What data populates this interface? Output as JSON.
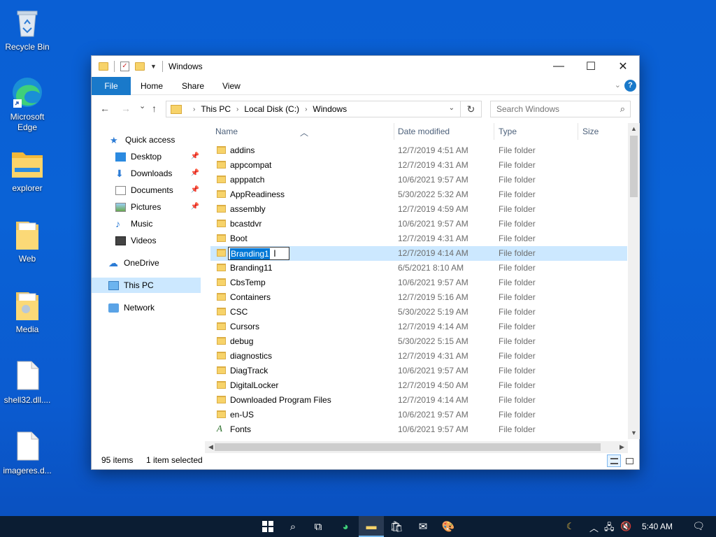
{
  "desktop": {
    "icons": [
      {
        "label": "Recycle Bin",
        "icon": "recycle-bin-icon"
      },
      {
        "label": "Microsoft Edge",
        "icon": "edge-icon"
      },
      {
        "label": "explorer",
        "icon": "folder-icon"
      },
      {
        "label": "Web",
        "icon": "folder-icon"
      },
      {
        "label": "Media",
        "icon": "folder-icon"
      },
      {
        "label": "shell32.dll....",
        "icon": "file-icon"
      },
      {
        "label": "imageres.d...",
        "icon": "file-icon"
      }
    ]
  },
  "window": {
    "title": "Windows",
    "controls": {
      "minimize": "—",
      "maximize": "☐",
      "close": "✕"
    },
    "ribbon": {
      "tabs": [
        "File",
        "Home",
        "Share",
        "View"
      ],
      "help": "?"
    },
    "nav": {
      "back": "←",
      "forward": "→",
      "recent": "⌄",
      "up": "↑",
      "breadcrumb": [
        "This PC",
        "Local Disk (C:)",
        "Windows"
      ],
      "search_placeholder": "Search Windows"
    },
    "navpane": {
      "quick_access": "Quick access",
      "pinned": [
        "Desktop",
        "Downloads",
        "Documents",
        "Pictures"
      ],
      "unpinned": [
        "Music",
        "Videos"
      ],
      "onedrive": "OneDrive",
      "this_pc": "This PC",
      "network": "Network"
    },
    "columns": {
      "name": "Name",
      "date": "Date modified",
      "type": "Type",
      "size": "Size"
    },
    "files": [
      {
        "name": "addins",
        "date": "12/7/2019 4:51 AM",
        "type": "File folder"
      },
      {
        "name": "appcompat",
        "date": "12/7/2019 4:31 AM",
        "type": "File folder"
      },
      {
        "name": "apppatch",
        "date": "10/6/2021 9:57 AM",
        "type": "File folder"
      },
      {
        "name": "AppReadiness",
        "date": "5/30/2022 5:32 AM",
        "type": "File folder"
      },
      {
        "name": "assembly",
        "date": "12/7/2019 4:59 AM",
        "type": "File folder"
      },
      {
        "name": "bcastdvr",
        "date": "10/6/2021 9:57 AM",
        "type": "File folder"
      },
      {
        "name": "Boot",
        "date": "12/7/2019 4:31 AM",
        "type": "File folder"
      },
      {
        "name": "Branding1",
        "date": "12/7/2019 4:14 AM",
        "type": "File folder"
      },
      {
        "name": "Branding11",
        "date": "6/5/2021 8:10 AM",
        "type": "File folder"
      },
      {
        "name": "CbsTemp",
        "date": "10/6/2021 9:57 AM",
        "type": "File folder"
      },
      {
        "name": "Containers",
        "date": "12/7/2019 5:16 AM",
        "type": "File folder"
      },
      {
        "name": "CSC",
        "date": "5/30/2022 5:19 AM",
        "type": "File folder"
      },
      {
        "name": "Cursors",
        "date": "12/7/2019 4:14 AM",
        "type": "File folder"
      },
      {
        "name": "debug",
        "date": "5/30/2022 5:15 AM",
        "type": "File folder"
      },
      {
        "name": "diagnostics",
        "date": "12/7/2019 4:31 AM",
        "type": "File folder"
      },
      {
        "name": "DiagTrack",
        "date": "10/6/2021 9:57 AM",
        "type": "File folder"
      },
      {
        "name": "DigitalLocker",
        "date": "12/7/2019 4:50 AM",
        "type": "File folder"
      },
      {
        "name": "Downloaded Program Files",
        "date": "12/7/2019 4:14 AM",
        "type": "File folder"
      },
      {
        "name": "en-US",
        "date": "10/6/2021 9:57 AM",
        "type": "File folder"
      },
      {
        "name": "Fonts",
        "date": "10/6/2021 9:57 AM",
        "type": "File folder"
      }
    ],
    "rename_value": "Branding1",
    "status": {
      "items": "95 items",
      "selected": "1 item selected"
    }
  },
  "taskbar": {
    "apps": [
      "start-icon",
      "search-icon",
      "task-view-icon",
      "edge-icon",
      "file-explorer-icon",
      "store-icon",
      "mail-icon",
      "paint-icon"
    ],
    "clock": "5:40 AM"
  },
  "colors": {
    "accent": "#1979ca",
    "selection": "#cce8ff",
    "folder": "#f7d36a",
    "desktop": "#0a5fd4",
    "taskbar": "#0b1d33"
  }
}
